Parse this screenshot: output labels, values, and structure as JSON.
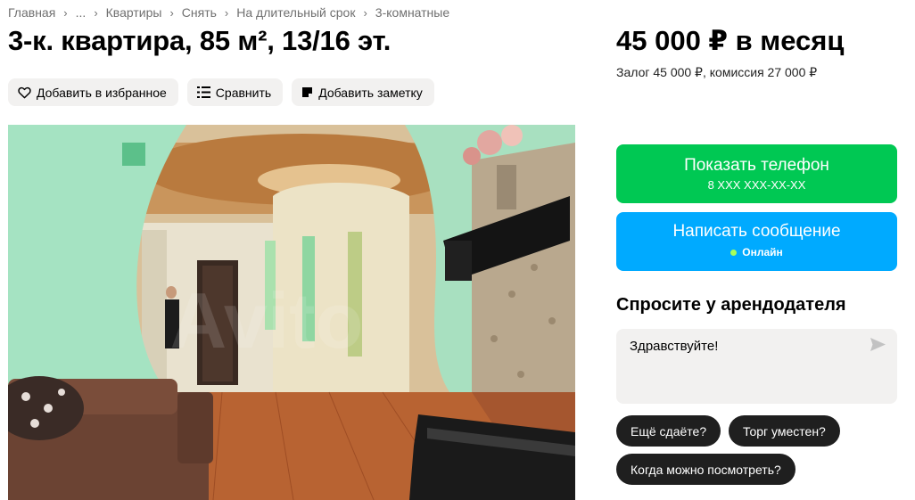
{
  "breadcrumbs": [
    "Главная",
    "...",
    "Квартиры",
    "Снять",
    "На длительный срок",
    "3-комнатные"
  ],
  "listing": {
    "title": "3-к. квартира, 85 м², 13/16 эт.",
    "price": "45 000 ₽ в месяц",
    "deposit_info": "Залог 45 000 ₽, комиссия 27 000 ₽"
  },
  "actions": {
    "favorite": "Добавить в избранное",
    "compare": "Сравнить",
    "note": "Добавить заметку"
  },
  "contact": {
    "phone_label": "Показать телефон",
    "phone_masked": "8 XXX XXX-XX-XX",
    "message_label": "Написать сообщение",
    "status": "Онлайн"
  },
  "ask": {
    "title": "Спросите у арендодателя",
    "message_value": "Здравствуйте!",
    "quick_questions": [
      "Ещё сдаёте?",
      "Торг уместен?",
      "Когда можно посмотреть?"
    ]
  },
  "photo": {
    "watermark": "Avito"
  },
  "colors": {
    "phone_button": "#00c853",
    "message_button": "#00aaff",
    "chip_bg": "#1f1f1f",
    "online_dot": "#a8ff5a"
  },
  "icons": {
    "favorite": "heart-icon",
    "compare": "compare-icon",
    "note": "note-icon",
    "send": "send-icon",
    "breadcrumb_separator": "chevron-right-icon"
  }
}
